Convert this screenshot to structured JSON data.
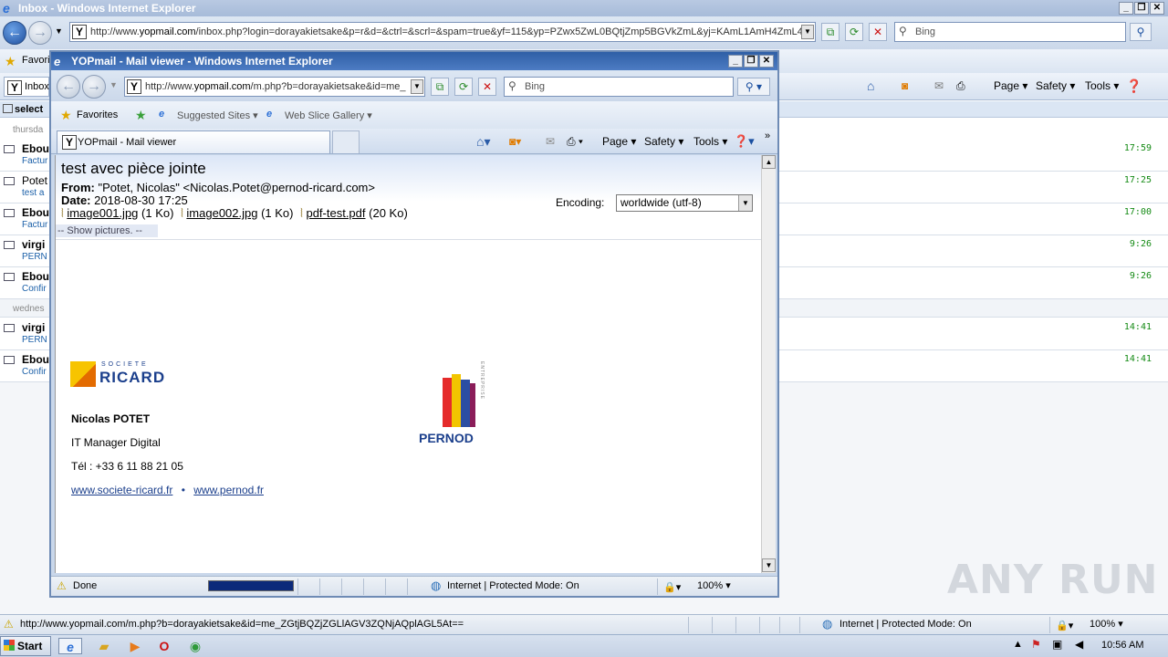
{
  "outer": {
    "title": "Inbox - Windows Internet Explorer",
    "address_prefix": "http://www.",
    "address_domain": "yopmail.com",
    "address_rest": "/inbox.php?login=dorayakietsake&p=r&d=&ctrl=&scrl=&spam=true&yf=115&yp=PZwx5ZwL0BQtjZmp5BGVkZmL&yj=KAmL1AmH4ZmL4Z",
    "search_placeholder": "Bing",
    "favorites_label": "Favori",
    "tab_label": "Inbox",
    "cmd_page": "Page",
    "cmd_safety": "Safety",
    "cmd_tools": "Tools",
    "select_label": "select",
    "day_thursday": "thursda",
    "day_wednesday": "wednes",
    "rows": [
      {
        "from": "Ebou",
        "sub": "Factur",
        "time": "17:59"
      },
      {
        "from": "Potet",
        "sub": "test a",
        "time": "17:25"
      },
      {
        "from": "Ebou",
        "sub": "Factur",
        "time": "17:00"
      },
      {
        "from": "virgi",
        "sub": "PERN",
        "time": "9:26"
      },
      {
        "from": "Ebou",
        "sub": "Confir",
        "time": "9:26"
      },
      {
        "from": "virgi",
        "sub": "PERN",
        "time": "14:41"
      },
      {
        "from": "Ebou",
        "sub": "Confir",
        "time": "14:41"
      }
    ],
    "status_url": "http://www.yopmail.com/m.php?b=dorayakietsake&id=me_ZGtjBQZjZGLlAGV3ZQNjAQplAGL5At==",
    "status_zone": "Internet | Protected Mode: On",
    "status_zoom": "100%"
  },
  "taskbar": {
    "start": "Start",
    "clock": "10:56 AM"
  },
  "watermark": "ANY RUN",
  "popup": {
    "title": "YOPmail - Mail viewer - Windows Internet Explorer",
    "address_prefix": "http://www.",
    "address_domain": "yopmail.com",
    "address_rest": "/m.php?b=dorayakietsake&id=me_",
    "search_placeholder": "Bing",
    "favorites_label": "Favorites",
    "suggested_sites": "Suggested Sites",
    "web_slice": "Web Slice Gallery",
    "tab_label": "YOPmail - Mail viewer",
    "cmd_page": "Page",
    "cmd_safety": "Safety",
    "cmd_tools": "Tools",
    "status_done": "Done",
    "status_zone": "Internet | Protected Mode: On",
    "status_zoom": "100%"
  },
  "mail": {
    "subject": "test avec pièce jointe",
    "from_label": "From:",
    "from_value": "\"Potet, Nicolas\" <Nicolas.Potet@pernod-ricard.com>",
    "date_label": "Date:",
    "date_value": "2018-08-30 17:25",
    "encoding_label": "Encoding:",
    "encoding_value": "worldwide (utf-8)",
    "attachments": [
      {
        "name": "image001.jpg",
        "size": "(1 Ko)"
      },
      {
        "name": "image002.jpg",
        "size": "(1 Ko)"
      },
      {
        "name": "pdf-test.pdf",
        "size": "(20 Ko)"
      }
    ],
    "show_pictures": "-- Show pictures. --",
    "logo_ricard_small": "SOCIETE",
    "logo_ricard": "RICARD",
    "logo_pernod": "PERNOD",
    "logo_pernod_side": "ENTREPRISE",
    "sig_name": "Nicolas POTET",
    "sig_title": "IT Manager Digital",
    "sig_phone": "Tél : +33 6 11 88 21 05",
    "sig_link1": "www.societe-ricard.fr",
    "sig_sep": "•",
    "sig_link2": "www.pernod.fr"
  }
}
